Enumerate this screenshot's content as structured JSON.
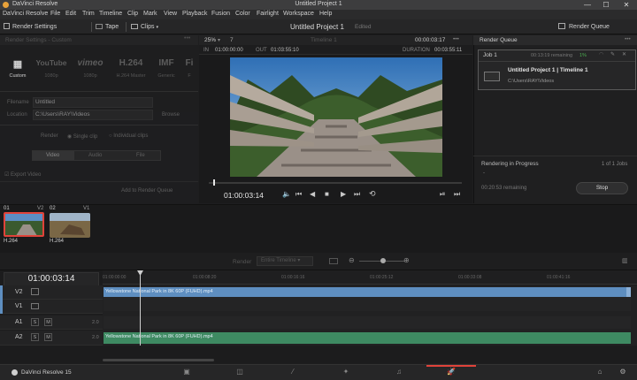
{
  "window": {
    "app_name": "DaVinci Resolve",
    "title": "Untitled Project 1",
    "min": "—",
    "max": "☐",
    "close": "✕"
  },
  "menu": [
    "DaVinci Resolve",
    "File",
    "Edit",
    "Trim",
    "Timeline",
    "Clip",
    "Mark",
    "View",
    "Playback",
    "Fusion",
    "Color",
    "Fairlight",
    "Workspace",
    "Help"
  ],
  "toolbar": {
    "render_settings": "Render Settings",
    "tape": "Tape",
    "clips": "Clips",
    "project_title": "Untitled Project 1",
    "edited": "Edited",
    "render_queue": "Render Queue"
  },
  "render_settings": {
    "header": "Render Settings - Custom",
    "formats": [
      {
        "logo": "▦",
        "label": "Custom"
      },
      {
        "logo": "YouTube",
        "label": "1080p"
      },
      {
        "logo": "vimeo",
        "label": "1080p"
      },
      {
        "logo": "H.264",
        "label": "H.264 Master"
      },
      {
        "logo": "IMF",
        "label": "Generic"
      },
      {
        "logo": "Fi",
        "label": "F"
      }
    ],
    "filename_label": "Filename",
    "filename_value": "Untitled",
    "location_label": "Location",
    "location_value": "C:\\Users\\RAY\\Videos",
    "browse": "Browse",
    "render_label": "Render",
    "single_clip": "Single clip",
    "individual_clips": "Individual clips",
    "tabs": [
      "Video",
      "Audio",
      "File"
    ],
    "export_video": "Export Video",
    "add_to_queue": "Add to Render Queue"
  },
  "viewer": {
    "zoom": "25%",
    "zoom_extra": "7",
    "timeline_name": "Timeline 1",
    "header_tc": "00:00:03:17",
    "in_label": "IN",
    "in_tc": "01:00:00:00",
    "out_label": "OUT",
    "out_tc": "01:03:55:10",
    "duration_label": "DURATION",
    "duration_tc": "00:03:55:11",
    "current_tc": "01:00:03:14",
    "playhead_fraction": 0.016
  },
  "render_queue": {
    "header": "Render Queue",
    "job_label": "Job 1",
    "job_remaining": "00:13:19 remaining",
    "job_percent": "1%",
    "job_title": "Untitled Project 1 | Timeline 1",
    "job_path": "C:\\Users\\RAY\\Videos",
    "status_label": "Rendering in Progress",
    "status_count": "1 of 1 Jobs",
    "status_dash": "-",
    "status_remaining": "00:20:53 remaining",
    "stop": "Stop"
  },
  "clips": [
    {
      "num": "01",
      "track": "V2",
      "codec": "H.264",
      "colors": [
        "#445c34",
        "#8a6f4a"
      ]
    },
    {
      "num": "02",
      "track": "V1",
      "codec": "H.264",
      "colors": [
        "#6c5a3e",
        "#a9895c"
      ]
    }
  ],
  "timeline": {
    "render_label": "Render",
    "render_option": "Entire Timeline",
    "timecode": "01:00:03:14",
    "ruler": [
      "01:00:00:00",
      "01:00:08:20",
      "01:00:16:16",
      "01:00:25:12",
      "01:00:33:08",
      "01:00:41:16"
    ],
    "tracks": [
      {
        "name": "V2",
        "kind": "video"
      },
      {
        "name": "V1",
        "kind": "video"
      },
      {
        "name": "A1",
        "kind": "audio",
        "level": "2.0"
      },
      {
        "name": "A2",
        "kind": "audio",
        "level": "2.0"
      }
    ],
    "video_clip": "Yellowstone National Park in 8K 60P (FUHD).mp4",
    "audio_clip": "Yellowstone National Park in 8K 60P (FUHD).mp4",
    "s_btn": "S",
    "m_btn": "M"
  },
  "bottom": {
    "app": "DaVinci Resolve 15",
    "pages": [
      "media",
      "cut",
      "edit",
      "fusion",
      "color",
      "fairlight",
      "deliver"
    ]
  },
  "colors": {
    "video_clip": "#5e8ec0",
    "audio_clip": "#3e8a62",
    "accent": "#e0433a",
    "progress": "#4caf50"
  }
}
